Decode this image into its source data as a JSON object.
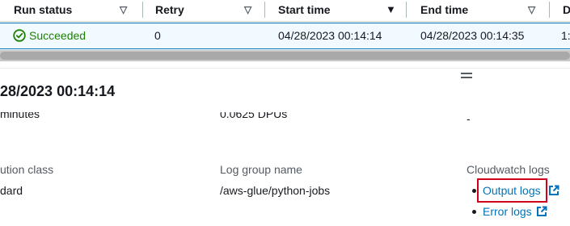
{
  "table": {
    "columns": [
      {
        "label": "Run status",
        "sort": "▽"
      },
      {
        "label": "Retry",
        "sort": "▽"
      },
      {
        "label": "Start time",
        "sort": "▼"
      },
      {
        "label": "End time",
        "sort": "▽"
      },
      {
        "label": "D",
        "sort": ""
      }
    ],
    "row": {
      "status": "Succeeded",
      "retry": "0",
      "start_time": "04/28/2023 00:14:14",
      "end_time": "04/28/2023 00:14:35",
      "extra": "1:"
    }
  },
  "details": {
    "title": "28/2023 00:14:14",
    "row1": {
      "col1": "minutes",
      "col2": "0.0625 DPUs",
      "col3": "-"
    },
    "execution_class_label": "ution class",
    "execution_class_value": "dard",
    "log_group_label": "Log group name",
    "log_group_value": "/aws-glue/python-jobs",
    "cloudwatch_label": "Cloudwatch logs",
    "output_logs": "Output logs",
    "error_logs": "Error logs"
  },
  "colors": {
    "success": "#1d8102",
    "link": "#0073bb",
    "highlight": "#d0021b",
    "selected_row": "#f1faff"
  }
}
